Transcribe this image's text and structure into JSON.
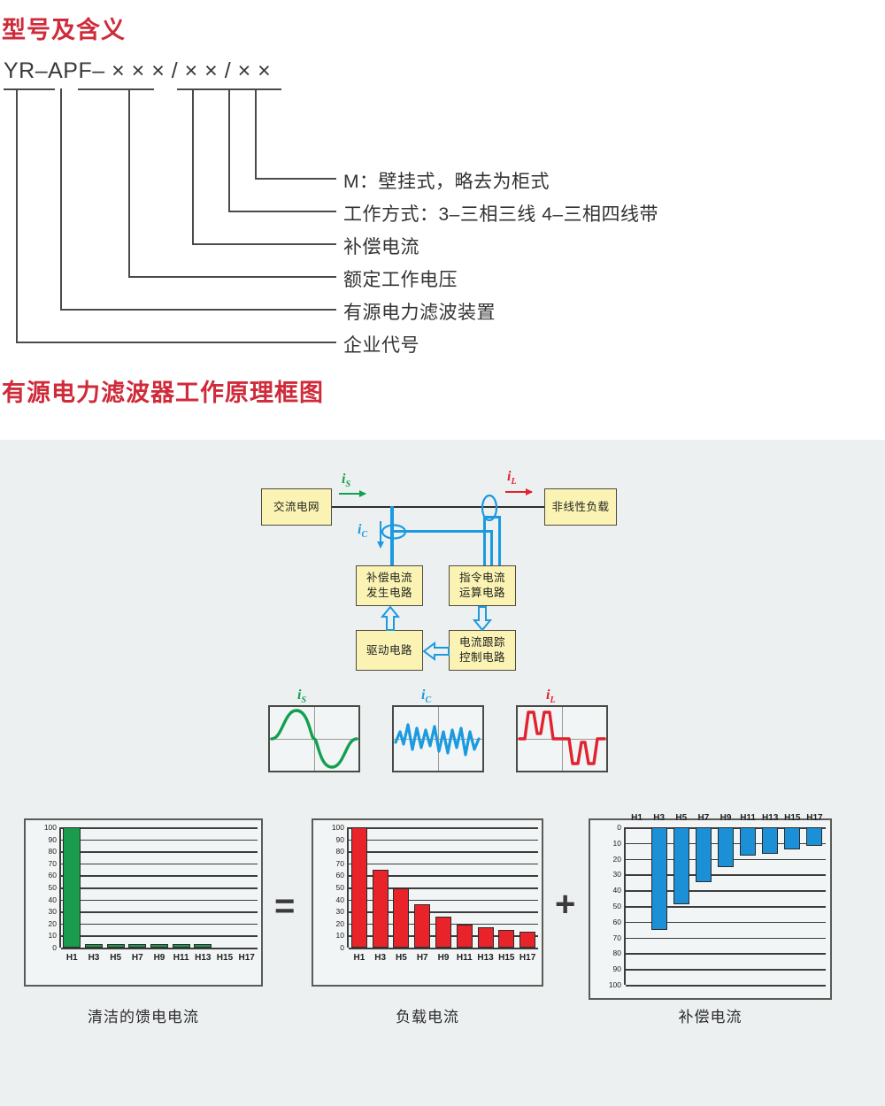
{
  "headings": {
    "model": "型号及含义",
    "principle": "有源电力滤波器工作原理框图",
    "color": "#cf2b3a"
  },
  "model_code": {
    "segments": [
      "YR",
      "–",
      "APF",
      "–",
      "× × ×",
      "/",
      "× ×",
      "/",
      "×",
      "×"
    ],
    "full_text": "YR–APF– × × × / × × / × ×",
    "leaders": [
      {
        "label": "M：壁挂式，略去为柜式"
      },
      {
        "label": "工作方式：3–三相三线  4–三相四线带"
      },
      {
        "label": "补偿电流"
      },
      {
        "label": "额定工作电压"
      },
      {
        "label": "有源电力滤波装置"
      },
      {
        "label": "企业代号"
      }
    ]
  },
  "diagram": {
    "blocks": {
      "grid": "交流电网",
      "load": "非线性负载",
      "comp_gen_l1": "补偿电流",
      "comp_gen_l2": "发生电路",
      "cmd_calc_l1": "指令电流",
      "cmd_calc_l2": "运算电路",
      "driver": "驱动电路",
      "track_l1": "电流跟踪",
      "track_l2": "控制电路"
    },
    "currents": {
      "is_symbol": "i",
      "is_sub": "S",
      "ic_symbol": "i",
      "ic_sub": "C",
      "il_symbol": "i",
      "il_sub": "L"
    },
    "colors": {
      "source": "#12a050",
      "comp": "#1b9ae0",
      "load": "#e0232e",
      "block_fill": "#faf3b4",
      "block_border": "#4e4a42",
      "panel_bg": "#edf0f1"
    }
  },
  "waveforms": [
    {
      "name": "is",
      "label_symbol": "i",
      "label_sub": "S",
      "color": "#12a050",
      "type": "sine"
    },
    {
      "name": "ic",
      "label_symbol": "i",
      "label_sub": "C",
      "color": "#1b9ae0",
      "type": "ripple"
    },
    {
      "name": "il",
      "label_symbol": "i",
      "label_sub": "L",
      "color": "#e0232e",
      "type": "square-harmonic"
    }
  ],
  "operators": {
    "equals": "=",
    "plus": "+"
  },
  "captions": {
    "clean": "清洁的馈电电流",
    "load": "负载电流",
    "comp": "补偿电流"
  },
  "chart_data": [
    {
      "type": "bar",
      "name": "clean-feed-current",
      "title": "清洁的馈电电流",
      "categories": [
        "H1",
        "H3",
        "H5",
        "H7",
        "H9",
        "H11",
        "H13",
        "H15",
        "H17"
      ],
      "values": [
        100,
        3,
        3,
        3,
        3,
        3,
        3,
        0,
        0
      ],
      "color": "#1a9b4e",
      "yticks": [
        100,
        90,
        80,
        70,
        60,
        50,
        40,
        30,
        20,
        10,
        0
      ],
      "ylim": [
        0,
        100
      ],
      "direction": "up",
      "grid": true,
      "xlabel": "",
      "ylabel": ""
    },
    {
      "type": "bar",
      "name": "load-current",
      "title": "负载电流",
      "categories": [
        "H1",
        "H3",
        "H5",
        "H7",
        "H9",
        "H11",
        "H13",
        "H15",
        "H17"
      ],
      "values": [
        100,
        65,
        49,
        36,
        26,
        19,
        17,
        15,
        13
      ],
      "color": "#e8232a",
      "yticks": [
        100,
        90,
        80,
        70,
        60,
        50,
        40,
        30,
        20,
        10,
        0
      ],
      "ylim": [
        0,
        100
      ],
      "direction": "up",
      "grid": true,
      "xlabel": "",
      "ylabel": ""
    },
    {
      "type": "bar",
      "name": "compensation-current",
      "title": "补偿电流",
      "categories": [
        "H1",
        "H3",
        "H5",
        "H7",
        "H9",
        "H11",
        "H13",
        "H15",
        "H17"
      ],
      "values": [
        0,
        65,
        49,
        35,
        25,
        18,
        17,
        14,
        12
      ],
      "color": "#1b90d6",
      "yticks": [
        0,
        10,
        20,
        30,
        40,
        50,
        60,
        70,
        80,
        90,
        100
      ],
      "ylim": [
        0,
        100
      ],
      "direction": "down",
      "grid": true,
      "xlabel": "",
      "ylabel": ""
    }
  ]
}
